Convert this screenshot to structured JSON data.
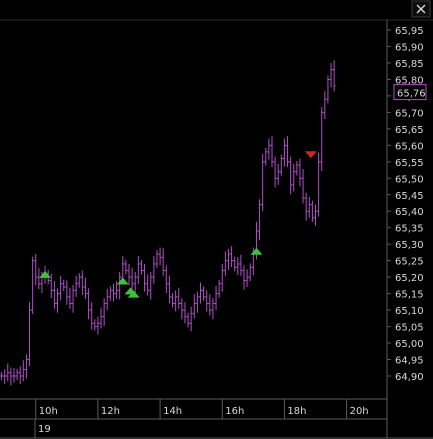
{
  "window": {
    "title_bar_label": "",
    "close_icon": "close-icon"
  },
  "chart_data": {
    "type": "ohlc",
    "colors": {
      "background": "#000000",
      "bars": "#b04fc8",
      "axis": "#5a5a5a",
      "buy_marker": "#3fc03f",
      "sell_marker": "#d02424",
      "last_price_border": "#b04fc8",
      "last_price_text": "#c060d8",
      "text": "#d8d8d8"
    },
    "y_axis": {
      "min": 64.9,
      "max": 65.95,
      "ticks": [
        "65,95",
        "65,90",
        "65,85",
        "65,80",
        "65,75",
        "65,70",
        "65,65",
        "65,60",
        "65,55",
        "65,50",
        "65,45",
        "65,40",
        "65,35",
        "65,30",
        "65,25",
        "65,20",
        "65,15",
        "65,10",
        "65,05",
        "65,00",
        "64,95",
        "64,90"
      ],
      "last_price_label": "65,76",
      "last_price_value": 65.76
    },
    "x_axis": {
      "hour_labels": [
        "10h",
        "12h",
        "14h",
        "16h",
        "18h",
        "20h"
      ],
      "hour_values": [
        10,
        12,
        14,
        16,
        18,
        20
      ],
      "date_label": "19",
      "range": [
        8.85,
        21.3
      ]
    },
    "series": [
      {
        "x": [
          8.9,
          9.0,
          9.1,
          9.2,
          9.3,
          9.4,
          9.5,
          9.6,
          9.7,
          9.8,
          9.9,
          10.0,
          10.1,
          10.2,
          10.3,
          10.4,
          10.5,
          10.6,
          10.7,
          10.8,
          10.9,
          11.0,
          11.1,
          11.2,
          11.3,
          11.4,
          11.5,
          11.6,
          11.7,
          11.8,
          11.9,
          12.0,
          12.1,
          12.2,
          12.3,
          12.4,
          12.5,
          12.6,
          12.7,
          12.8,
          12.9,
          13.0,
          13.1,
          13.2,
          13.3,
          13.4,
          13.5,
          13.6,
          13.7,
          13.8,
          13.9,
          14.0,
          14.1,
          14.2,
          14.3,
          14.4,
          14.5,
          14.6,
          14.7,
          14.8,
          14.9,
          15.0,
          15.1,
          15.2,
          15.3,
          15.4,
          15.5,
          15.6,
          15.7,
          15.8,
          15.9,
          16.0,
          16.1,
          16.2,
          16.3,
          16.4,
          16.5,
          16.6,
          16.7,
          16.8,
          16.9,
          17.0,
          17.1,
          17.2,
          17.3,
          17.4,
          17.5,
          17.6,
          17.7,
          17.8,
          17.9,
          18.0,
          18.1,
          18.2,
          18.3,
          18.4,
          18.5,
          18.6,
          18.7,
          18.8,
          18.9,
          19.0,
          19.1,
          19.2,
          19.3,
          19.4,
          19.5,
          19.6,
          19.7,
          19.8,
          19.9,
          20.0,
          20.1,
          20.2,
          20.3,
          20.4,
          20.5,
          20.6,
          20.7,
          20.8,
          20.9,
          21.0,
          21.1
        ],
        "close": [
          64.9,
          64.9,
          64.91,
          64.9,
          64.9,
          64.91,
          64.9,
          64.92,
          64.95,
          65.1,
          65.25,
          65.2,
          65.18,
          65.2,
          65.21,
          65.19,
          65.16,
          65.12,
          65.15,
          65.18,
          65.17,
          65.14,
          65.12,
          65.16,
          65.18,
          65.2,
          65.17,
          65.15,
          65.1,
          65.06,
          65.05,
          65.06,
          65.08,
          65.12,
          65.14,
          65.16,
          65.15,
          65.16,
          65.2,
          65.24,
          65.22,
          65.2,
          65.18,
          65.2,
          65.24,
          65.22,
          65.18,
          65.16,
          65.2,
          65.24,
          65.27,
          65.26,
          65.22,
          65.18,
          65.14,
          65.12,
          65.14,
          65.12,
          65.1,
          65.08,
          65.06,
          65.09,
          65.12,
          65.14,
          65.16,
          65.14,
          65.12,
          65.1,
          65.12,
          65.15,
          65.18,
          65.22,
          65.25,
          65.27,
          65.25,
          65.23,
          65.24,
          65.22,
          65.19,
          65.2,
          65.23,
          65.27,
          65.34,
          65.42,
          65.55,
          65.58,
          65.6,
          65.55,
          65.5,
          65.52,
          65.56,
          65.6,
          65.55,
          65.48,
          65.52,
          65.54,
          65.5,
          65.44,
          65.4,
          65.42,
          65.38,
          65.4,
          65.55,
          65.7,
          65.74,
          65.8,
          65.83,
          65.78
        ]
      }
    ],
    "signals": [
      {
        "type": "buy",
        "x": 10.3,
        "y": 65.21
      },
      {
        "type": "buy",
        "x": 12.8,
        "y": 65.19
      },
      {
        "type": "buy",
        "x": 13.05,
        "y": 65.16
      },
      {
        "type": "buy",
        "x": 13.15,
        "y": 65.15
      },
      {
        "type": "buy",
        "x": 17.1,
        "y": 65.28
      },
      {
        "type": "sell",
        "x": 18.85,
        "y": 65.57
      }
    ]
  }
}
